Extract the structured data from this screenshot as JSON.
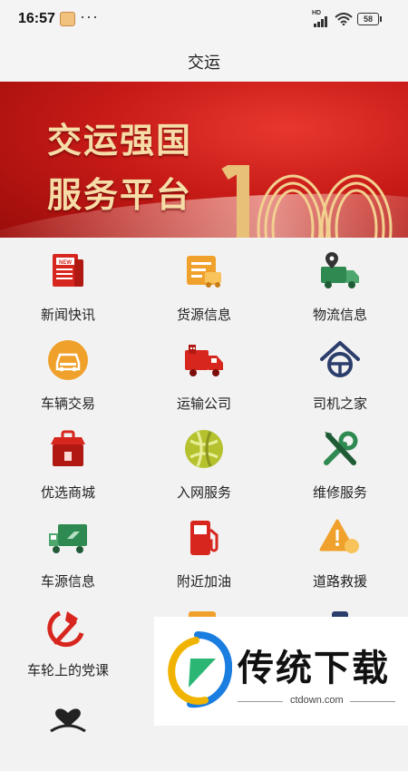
{
  "status_bar": {
    "time": "16:57",
    "more": "···",
    "network": "HD",
    "battery": "58"
  },
  "header": {
    "title": "交运"
  },
  "banner": {
    "line1": "交运强国",
    "line2": "服务平台",
    "number": "100"
  },
  "menu": [
    {
      "label": "新闻快讯",
      "icon": "newspaper-icon"
    },
    {
      "label": "货源信息",
      "icon": "cargo-source-icon"
    },
    {
      "label": "物流信息",
      "icon": "logistics-truck-icon"
    },
    {
      "label": "车辆交易",
      "icon": "car-trade-icon"
    },
    {
      "label": "运输公司",
      "icon": "transport-company-icon"
    },
    {
      "label": "司机之家",
      "icon": "driver-home-icon"
    },
    {
      "label": "优选商城",
      "icon": "mall-icon"
    },
    {
      "label": "入网服务",
      "icon": "network-service-icon"
    },
    {
      "label": "维修服务",
      "icon": "repair-tools-icon"
    },
    {
      "label": "车源信息",
      "icon": "vehicle-source-icon"
    },
    {
      "label": "附近加油",
      "icon": "fuel-pump-icon"
    },
    {
      "label": "道路救援",
      "icon": "road-rescue-icon"
    },
    {
      "label": "车轮上的党课",
      "icon": "party-emblem-icon"
    }
  ],
  "watermark": {
    "brand": "传统下载",
    "url": "ctdown.com"
  },
  "colors": {
    "accent_red": "#d7261e",
    "banner_gold": "#f6dca6",
    "icon_orange": "#f0a12c",
    "icon_green": "#2f8a52",
    "icon_navy": "#2b3d6b"
  }
}
